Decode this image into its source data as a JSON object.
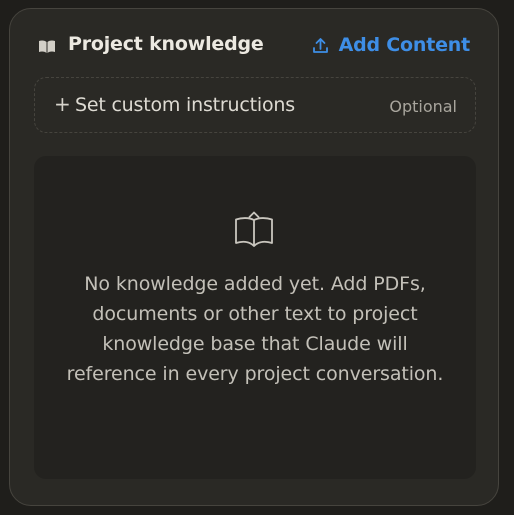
{
  "header": {
    "title": "Project knowledge",
    "title_icon": "book-icon",
    "add_button_label": "Add Content",
    "add_button_icon": "upload-icon"
  },
  "instructions": {
    "icon": "plus-icon",
    "plus": "+",
    "label": "Set custom instructions",
    "optional_label": "Optional"
  },
  "empty_state": {
    "icon": "open-book-icon",
    "message": "No knowledge added yet. Add PDFs, documents or other text to project knowledge base that Claude will reference in every project conversation."
  },
  "colors": {
    "accent": "#3e8ee6",
    "panel_bg": "#2a2925",
    "page_bg": "#1f1e1b",
    "empty_bg": "#23221f",
    "border": "#46443e"
  }
}
